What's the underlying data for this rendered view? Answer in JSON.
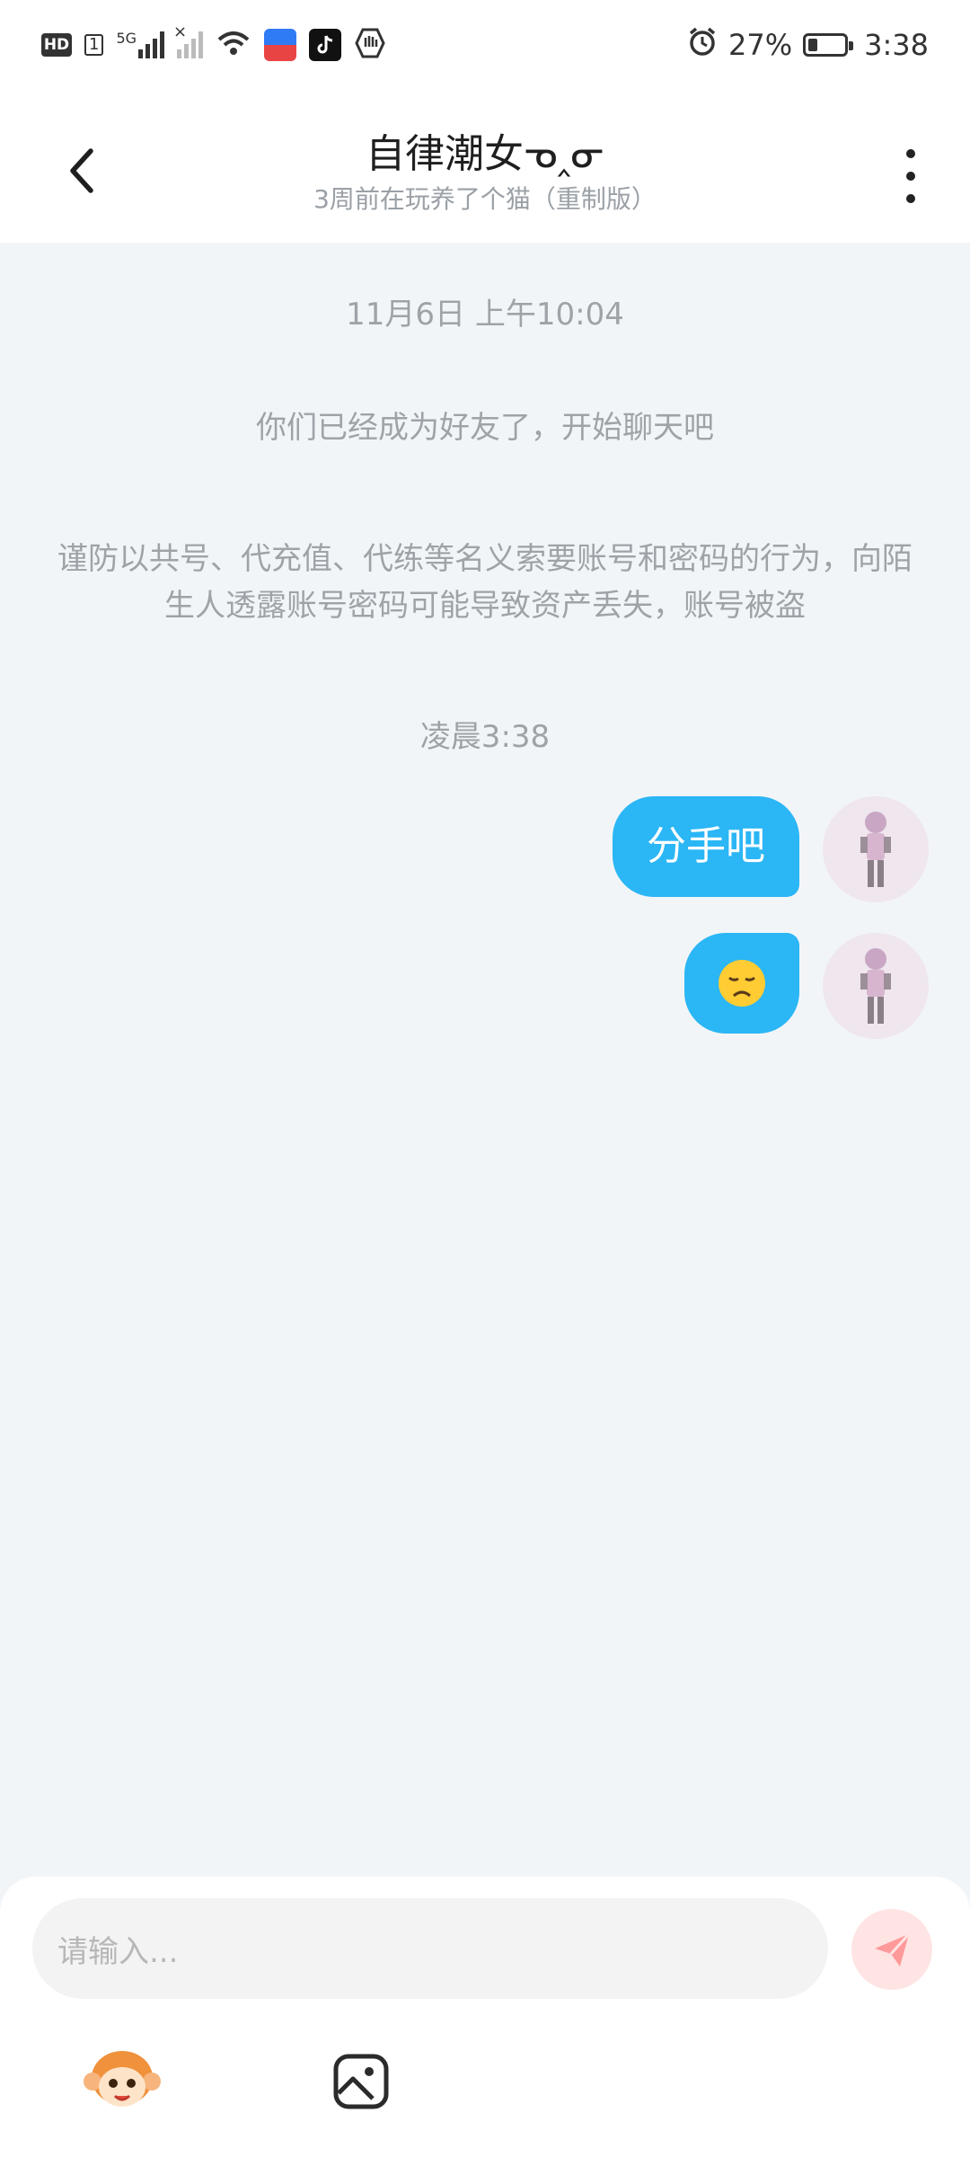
{
  "status_bar": {
    "hd_label": "HD",
    "sim_label": "1",
    "network_label": "5G",
    "battery_percent": "27%",
    "battery_level": 0.27,
    "time": "3:38",
    "icons": [
      "hd-icon",
      "signal-icon",
      "no-signal-icon",
      "wifi-icon",
      "shopping-app-icon",
      "tiktok-icon",
      "hand-app-icon",
      "alarm-icon",
      "battery-icon"
    ]
  },
  "header": {
    "title": "自律潮女ᓀ‸ᓂ",
    "subtitle": "3周前在玩养了个猫（重制版）"
  },
  "chat": {
    "date_stamp": "11月6日 上午10:04",
    "friend_notice": "你们已经成为好友了，开始聊天吧",
    "warning": "谨防以共号、代充值、代练等名义索要账号和密码的行为，向陌生人透露账号密码可能导致资产丢失，账号被盗",
    "time_stamp": "凌晨3:38",
    "messages": [
      {
        "from": "me",
        "type": "text",
        "text": "分手吧"
      },
      {
        "from": "me",
        "type": "emoji",
        "text": "😞"
      }
    ]
  },
  "input": {
    "placeholder": "请输入..."
  },
  "colors": {
    "bubble": "#2bb6f5",
    "background": "#f2f5f8",
    "send_button": "#ffe4e4",
    "send_icon": "#ff8f8f"
  }
}
